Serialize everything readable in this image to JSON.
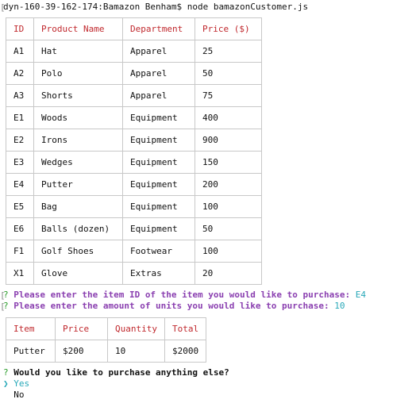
{
  "terminal": {
    "command_line": "dyn-160-39-162-174:Bamazon Benham$ node bamazonCustomer.js"
  },
  "products": {
    "headers": [
      "ID",
      "Product Name",
      "Department",
      "Price ($)"
    ],
    "rows": [
      [
        "A1",
        "Hat",
        "Apparel",
        "25"
      ],
      [
        "A2",
        "Polo",
        "Apparel",
        "50"
      ],
      [
        "A3",
        "Shorts",
        "Apparel",
        "75"
      ],
      [
        "E1",
        "Woods",
        "Equipment",
        "400"
      ],
      [
        "E2",
        "Irons",
        "Equipment",
        "900"
      ],
      [
        "E3",
        "Wedges",
        "Equipment",
        "150"
      ],
      [
        "E4",
        "Putter",
        "Equipment",
        "200"
      ],
      [
        "E5",
        "Bag",
        "Equipment",
        "100"
      ],
      [
        "E6",
        "Balls (dozen)",
        "Equipment",
        "50"
      ],
      [
        "F1",
        "Golf Shoes",
        "Footwear",
        "100"
      ],
      [
        "X1",
        "Glove",
        "Extras",
        "20"
      ]
    ]
  },
  "prompts": {
    "item_question_mark": "?",
    "item_question": "Please enter the item ID of the item you would like to purchase:",
    "item_answer": "E4",
    "units_question_mark": "?",
    "units_question": "Please enter the amount of units you would like to purchase:",
    "units_answer": "10"
  },
  "order": {
    "headers": [
      "Item",
      "Price",
      "Quantity",
      "Total"
    ],
    "row": [
      "Putter",
      "$200",
      "10",
      "$2000"
    ]
  },
  "continue_prompt": {
    "question_mark": "?",
    "question": "Would you like to purchase anything else?",
    "pointer": "❯",
    "options": [
      "Yes",
      "No"
    ]
  },
  "colors": {
    "header_red": "#c0282d",
    "prompt_purple": "#8a3fb0",
    "answer_cyan": "#27a8b8",
    "question_green": "#2a9c2a"
  }
}
